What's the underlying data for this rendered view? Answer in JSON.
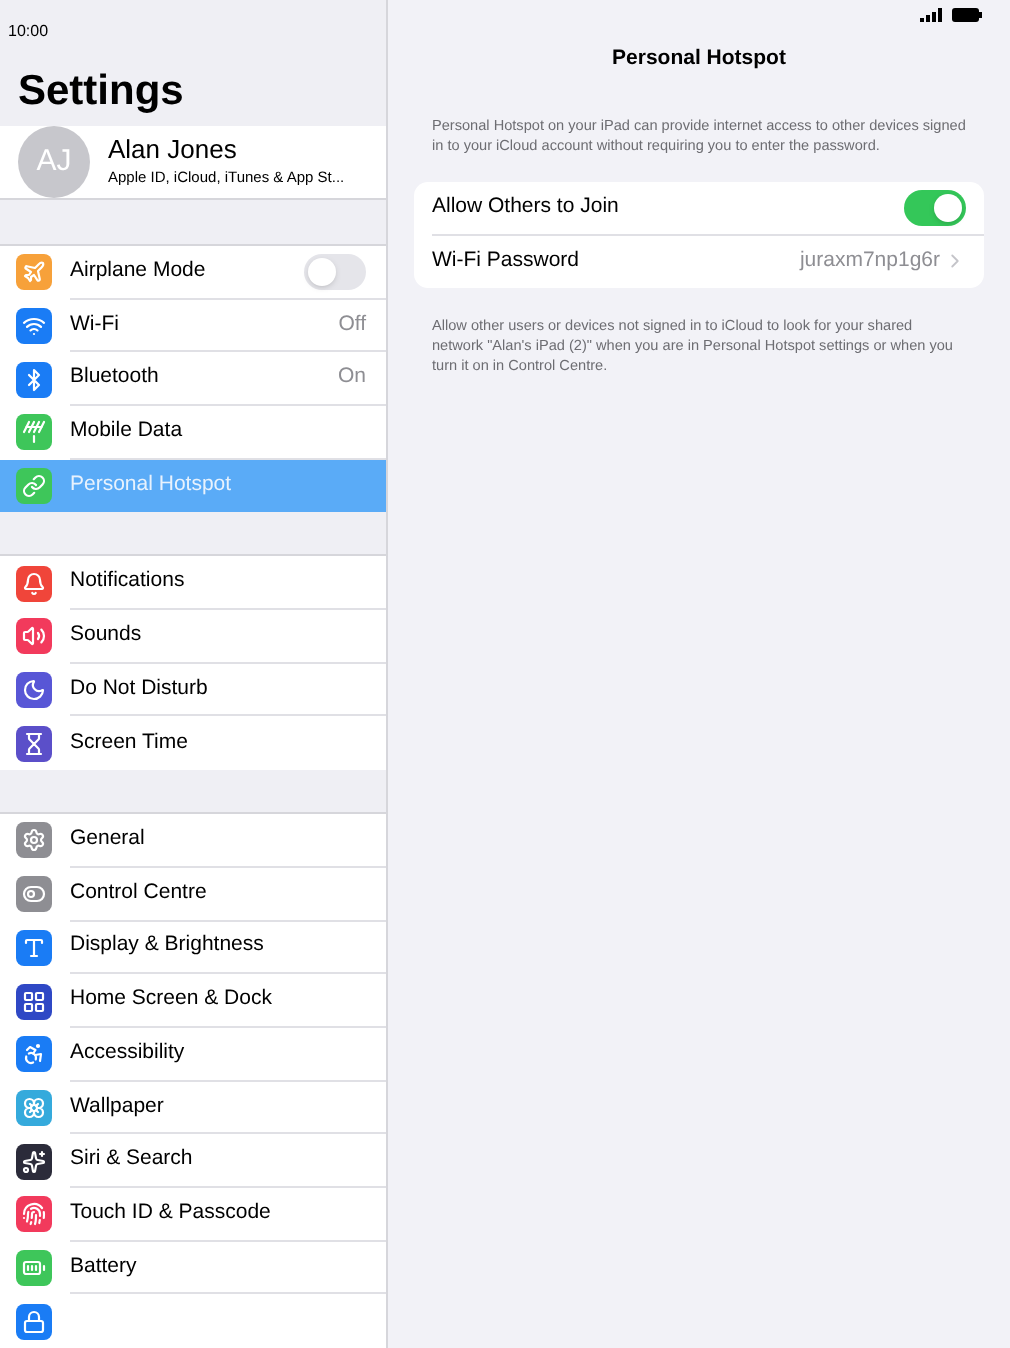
{
  "status_bar": {
    "time": "10:00"
  },
  "sidebar": {
    "title": "Settings",
    "profile": {
      "initials": "AJ",
      "name": "Alan Jones",
      "subtitle": "Apple ID, iCloud, iTunes & App St..."
    },
    "groups": [
      {
        "items": [
          {
            "label": "Airplane Mode",
            "kind": "toggle",
            "on": false,
            "selected": false,
            "color": "#f7a13a"
          },
          {
            "label": "Wi-Fi",
            "kind": "value",
            "value": "Off",
            "selected": false,
            "color": "#1a7cf5"
          },
          {
            "label": "Bluetooth",
            "kind": "value",
            "value": "On",
            "selected": false,
            "color": "#1a7cf5"
          },
          {
            "label": "Mobile Data",
            "kind": "plain",
            "selected": false,
            "color": "#3ec65a"
          },
          {
            "label": "Personal Hotspot",
            "kind": "plain",
            "selected": true,
            "color": "#3ec65a"
          }
        ]
      },
      {
        "items": [
          {
            "label": "Notifications",
            "kind": "plain",
            "selected": false,
            "color": "#f0453a"
          },
          {
            "label": "Sounds",
            "kind": "plain",
            "selected": false,
            "color": "#f23a5c"
          },
          {
            "label": "Do Not Disturb",
            "kind": "plain",
            "selected": false,
            "color": "#5856d6"
          },
          {
            "label": "Screen Time",
            "kind": "plain",
            "selected": false,
            "color": "#5b4fc9"
          }
        ]
      },
      {
        "items": [
          {
            "label": "General",
            "kind": "plain",
            "selected": false,
            "color": "#8e8e93"
          },
          {
            "label": "Control Centre",
            "kind": "plain",
            "selected": false,
            "color": "#8e8e93"
          },
          {
            "label": "Display & Brightness",
            "kind": "plain",
            "selected": false,
            "color": "#1a7cf5"
          },
          {
            "label": "Home Screen & Dock",
            "kind": "plain",
            "selected": false,
            "color": "#2f48c5"
          },
          {
            "label": "Accessibility",
            "kind": "plain",
            "selected": false,
            "color": "#1a7cf5"
          },
          {
            "label": "Wallpaper",
            "kind": "plain",
            "selected": false,
            "color": "#35aadc"
          },
          {
            "label": "Siri & Search",
            "kind": "plain",
            "selected": false,
            "color": "#2b2b3a"
          },
          {
            "label": "Touch ID & Passcode",
            "kind": "plain",
            "selected": false,
            "color": "#f23a5c"
          },
          {
            "label": "Battery",
            "kind": "plain",
            "selected": false,
            "color": "#3ec65a"
          },
          {
            "kind": "plain",
            "selected": false,
            "color": "#1a7cf5"
          }
        ]
      }
    ]
  },
  "detail": {
    "title": "Personal Hotspot",
    "description": "Personal Hotspot on your iPad can provide internet access to other devices signed in to your iCloud account without requiring you to enter the password.",
    "rows": [
      {
        "label": "Allow Others to Join",
        "kind": "toggle",
        "on": true
      },
      {
        "label": "Wi-Fi Password",
        "kind": "link",
        "value": "juraxm7np1g6r"
      }
    ],
    "footer": "Allow other users or devices not signed in to iCloud to look for your shared network \"Alan's iPad (2)\" when you are in Personal Hotspot settings or when you turn it on in Control Centre."
  }
}
